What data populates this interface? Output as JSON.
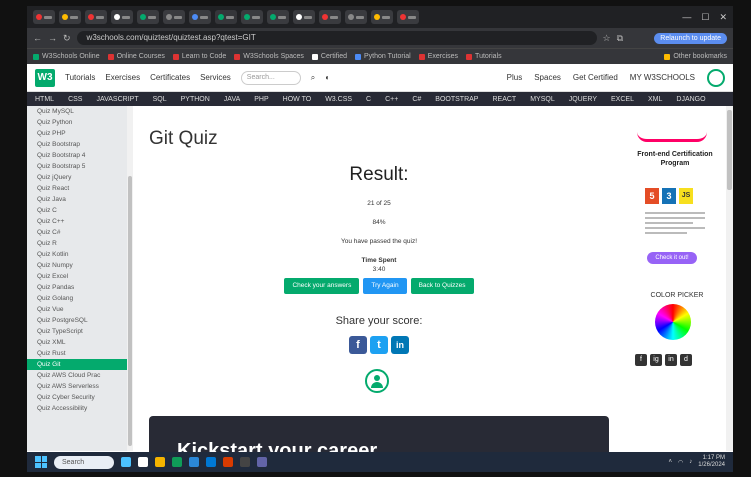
{
  "browser": {
    "url": "w3schools.com/quiztest/quiztest.asp?qtest=GIT",
    "profile_label": "Relaunch to update",
    "bookmarks": [
      "W3Schools Online",
      "Online Courses",
      "Learn to Code",
      "W3Schools Spaces",
      "Certified",
      "Python Tutorial",
      "Exercises",
      "Tutorials",
      "Other bookmarks"
    ]
  },
  "w3": {
    "logo": "W3",
    "menus": [
      "Tutorials",
      "Exercises",
      "Certificates",
      "Services"
    ],
    "search_placeholder": "Search...",
    "right_links": [
      "Plus",
      "Spaces",
      "Get Certified",
      "MY W3SCHOOLS"
    ],
    "topnav": [
      "HTML",
      "CSS",
      "JAVASCRIPT",
      "SQL",
      "PYTHON",
      "JAVA",
      "PHP",
      "HOW TO",
      "W3.CSS",
      "C",
      "C++",
      "C#",
      "BOOTSTRAP",
      "REACT",
      "MYSQL",
      "JQUERY",
      "EXCEL",
      "XML",
      "DJANGO"
    ]
  },
  "sidebar": {
    "items": [
      "Quiz MySQL",
      "Quiz Python",
      "Quiz PHP",
      "Quiz Bootstrap",
      "Quiz Bootstrap 4",
      "Quiz Bootstrap 5",
      "Quiz jQuery",
      "Quiz React",
      "Quiz Java",
      "Quiz C",
      "Quiz C++",
      "Quiz C#",
      "Quiz R",
      "Quiz Kotlin",
      "Quiz Numpy",
      "Quiz Excel",
      "Quiz Pandas",
      "Quiz Golang",
      "Quiz Vue",
      "Quiz PostgreSQL",
      "Quiz TypeScript",
      "Quiz XML",
      "Quiz Rust",
      "Quiz Git",
      "Quiz AWS Cloud Prac",
      "Quiz AWS Serverless",
      "Quiz Cyber Security",
      "Quiz Accessibility"
    ],
    "active_index": 23
  },
  "main": {
    "title": "Git Quiz",
    "result_heading": "Result:",
    "score": "21 of 25",
    "percent": "84%",
    "message": "You have passed the quiz!",
    "time_label": "Time Spent",
    "time_value": "3:40",
    "buttons": {
      "check": "Check your answers",
      "try_again": "Try Again",
      "back": "Back to Quizzes"
    },
    "share_label": "Share your score:",
    "social": [
      "f",
      "t",
      "in"
    ],
    "banner_text": "Kickstart your career"
  },
  "right": {
    "ad_title": "Front-end Certification Program",
    "badges": [
      "5",
      "3",
      "JS"
    ],
    "ad_button": "Check it out!",
    "color_picker": "COLOR PICKER",
    "social": [
      "f",
      "ig",
      "in",
      "d"
    ]
  },
  "taskbar": {
    "search": "Search",
    "time": "1:17 PM",
    "date": "1/26/2024"
  },
  "colors": {
    "brand_green": "#04aa6d",
    "nav_dark": "#282a35",
    "blue": "#2196f3"
  }
}
